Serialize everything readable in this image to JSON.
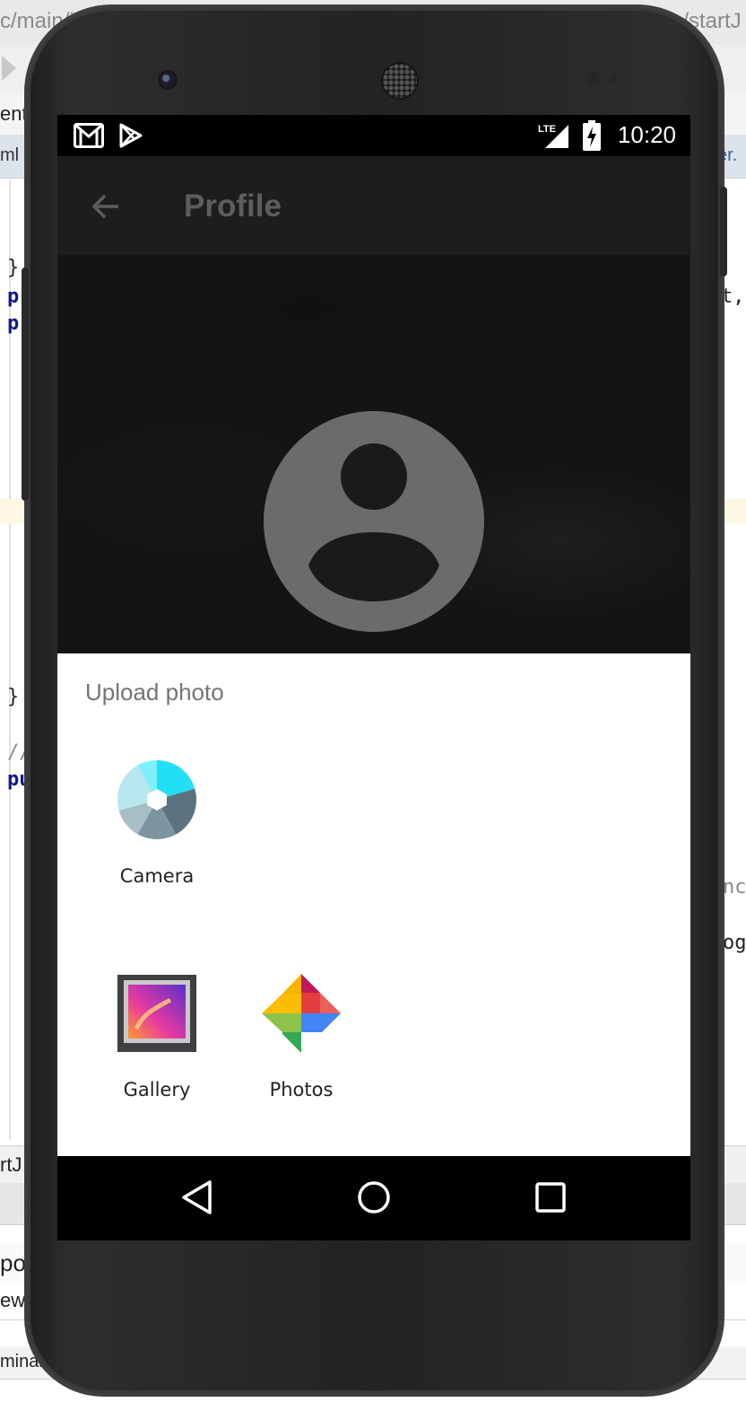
{
  "ide": {
    "path_text": "c/main/j",
    "path_text_right": "e/startJ",
    "tab_left": "ent",
    "file_left": "ml",
    "file_right": "er.",
    "code_lines": [
      "}",
      "p",
      "p",
      "}",
      "//",
      "pu"
    ],
    "code_right_1": "t,",
    "code_right_2": "nc",
    "code_right_3": "og",
    "bottom_1": "rtJ",
    "bottom_2": "pos",
    "bottom_3": "ew",
    "bottom_4": "minal"
  },
  "status_bar": {
    "time": "10:20",
    "network": "LTE",
    "icons": [
      "gmail-icon",
      "play-store-icon",
      "lte-signal-icon",
      "battery-charging-icon"
    ]
  },
  "toolbar": {
    "title": "Profile",
    "back_icon": "arrow-back-icon"
  },
  "avatar": {
    "icon": "account-circle-icon",
    "color": "#6b6b6b"
  },
  "sheet": {
    "title": "Upload photo",
    "apps": [
      {
        "label": "Camera",
        "icon": "camera-app-icon"
      },
      {
        "label": "Gallery",
        "icon": "gallery-app-icon"
      },
      {
        "label": "Photos",
        "icon": "google-photos-icon"
      }
    ]
  },
  "nav_bar": {
    "buttons": [
      "back-nav-icon",
      "home-nav-icon",
      "recents-nav-icon"
    ]
  },
  "colors": {
    "scrim": "#1b1b1b",
    "sheet_bg": "#ffffff",
    "sheet_title": "#757575",
    "status_bar": "#000000"
  }
}
